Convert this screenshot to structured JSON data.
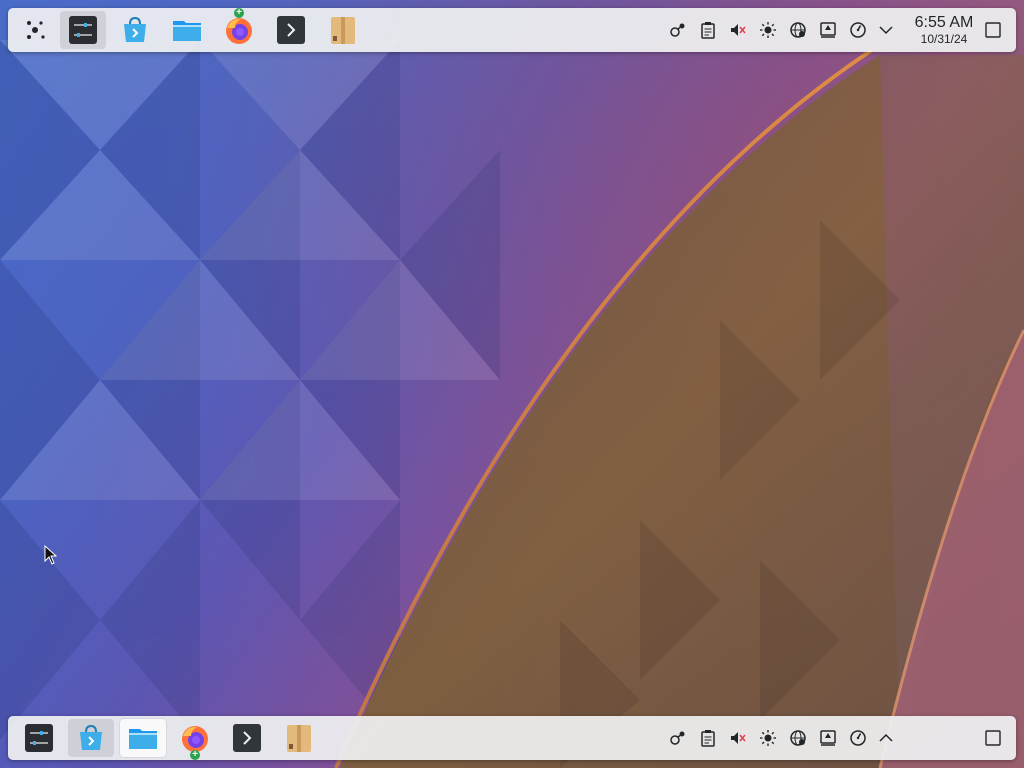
{
  "wallpaper": {
    "name": "kde-plasma-wallpaper"
  },
  "top_panel": {
    "launcher": {
      "icon": "application-launcher-icon"
    },
    "tasks": [
      {
        "name": "system-settings",
        "icon": "system-settings-icon",
        "active": true
      },
      {
        "name": "discover",
        "icon": "discover-store-icon",
        "active": false
      },
      {
        "name": "dolphin",
        "icon": "folder-icon",
        "active": false
      },
      {
        "name": "firefox",
        "icon": "firefox-icon",
        "active": false,
        "badge": "+"
      },
      {
        "name": "konsole",
        "icon": "terminal-icon",
        "active": false
      },
      {
        "name": "archive",
        "icon": "archive-package-icon",
        "active": false
      }
    ],
    "tray": [
      {
        "name": "kde-connect",
        "icon": "kde-connect-icon"
      },
      {
        "name": "clipboard",
        "icon": "clipboard-icon"
      },
      {
        "name": "volume",
        "icon": "volume-muted-icon"
      },
      {
        "name": "brightness",
        "icon": "brightness-icon"
      },
      {
        "name": "network",
        "icon": "network-globe-icon"
      },
      {
        "name": "updates",
        "icon": "update-notifier-icon"
      },
      {
        "name": "power-profile",
        "icon": "power-profile-icon"
      },
      {
        "name": "tray-expand",
        "icon": "chevron-down-icon"
      }
    ],
    "clock": {
      "time": "6:55 AM",
      "date": "10/31/24"
    },
    "show_desktop": {
      "icon": "show-desktop-icon"
    }
  },
  "bottom_panel": {
    "tasks": [
      {
        "name": "system-settings",
        "icon": "system-settings-icon"
      },
      {
        "name": "discover",
        "icon": "discover-store-icon"
      },
      {
        "name": "dolphin",
        "icon": "folder-icon"
      },
      {
        "name": "firefox",
        "icon": "firefox-icon",
        "badge": "+"
      },
      {
        "name": "konsole",
        "icon": "terminal-icon"
      },
      {
        "name": "archive",
        "icon": "archive-package-icon"
      }
    ],
    "tray": [
      {
        "name": "kde-connect",
        "icon": "kde-connect-icon"
      },
      {
        "name": "clipboard",
        "icon": "clipboard-icon"
      },
      {
        "name": "volume",
        "icon": "volume-muted-icon"
      },
      {
        "name": "brightness",
        "icon": "brightness-icon"
      },
      {
        "name": "network",
        "icon": "network-globe-icon"
      },
      {
        "name": "updates",
        "icon": "update-notifier-icon"
      },
      {
        "name": "power-profile",
        "icon": "power-profile-icon"
      },
      {
        "name": "tray-expand",
        "icon": "chevron-up-icon"
      }
    ],
    "show_desktop": {
      "icon": "show-desktop-icon"
    }
  },
  "colors": {
    "panel_bg": "#eff0f1",
    "text": "#232629",
    "accent_blue": "#3daee9",
    "wallpaper_orange": "#e69438",
    "wallpaper_blue": "#4a6cc9",
    "badge_green": "#2ca24e"
  }
}
